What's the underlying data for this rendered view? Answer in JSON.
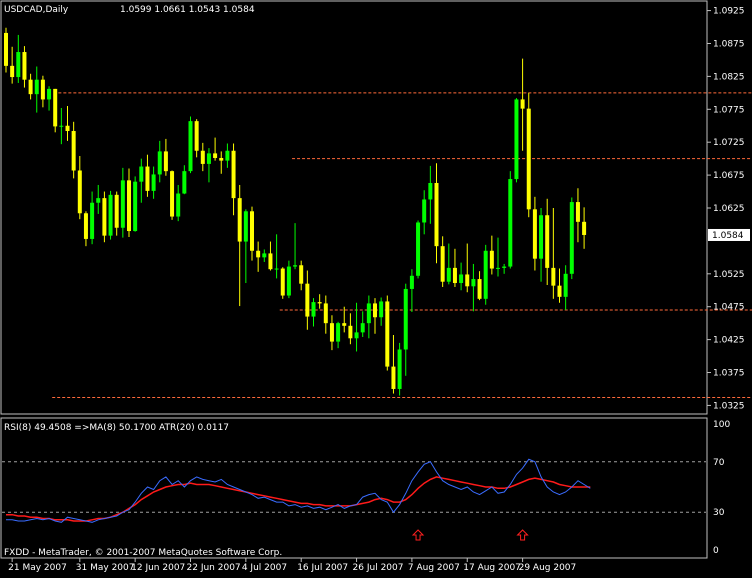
{
  "chart_data": [
    {
      "type": "candlestick",
      "title": "USDCAD,Daily",
      "ohlc_readout": "1.0599 1.0661 1.0543 1.0584",
      "current_price_label": "1.0584",
      "current_price": 1.0584,
      "ylim": [
        1.0315,
        1.0935
      ],
      "price_ticks": [
        {
          "v": 1.0925,
          "label": "1.0925"
        },
        {
          "v": 1.0875,
          "label": "1.0875"
        },
        {
          "v": 1.0825,
          "label": "1.0825"
        },
        {
          "v": 1.0775,
          "label": "1.0775"
        },
        {
          "v": 1.0725,
          "label": "1.0725"
        },
        {
          "v": 1.0675,
          "label": "1.0675"
        },
        {
          "v": 1.0625,
          "label": "1.0625"
        },
        {
          "v": 1.0525,
          "label": "1.0525"
        },
        {
          "v": 1.0475,
          "label": "1.0475"
        },
        {
          "v": 1.0425,
          "label": "1.0425"
        },
        {
          "v": 1.0375,
          "label": "1.0375"
        },
        {
          "v": 1.0325,
          "label": "1.0325"
        }
      ],
      "bull_color": "#00ff00",
      "bear_color": "#ffff00",
      "level_color": "#ff6a3a",
      "levels": [
        {
          "price": 1.08,
          "from": 9,
          "to": 134
        },
        {
          "price": 1.07,
          "from": 47,
          "to": 134
        },
        {
          "price": 1.047,
          "from": 45,
          "to": 134
        },
        {
          "price": 1.0337,
          "from": 8,
          "to": 134
        }
      ],
      "candles": [
        [
          1.0891,
          1.0899,
          1.0831,
          1.0841
        ],
        [
          1.0841,
          1.087,
          1.0814,
          1.0824
        ],
        [
          1.0824,
          1.0888,
          1.0815,
          1.0862
        ],
        [
          1.0862,
          1.0871,
          1.0808,
          1.082
        ],
        [
          1.082,
          1.0829,
          1.079,
          1.0798
        ],
        [
          1.0798,
          1.084,
          1.077,
          1.082
        ],
        [
          1.082,
          1.0826,
          1.0778,
          1.079
        ],
        [
          1.079,
          1.081,
          1.0773,
          1.0806
        ],
        [
          1.0806,
          1.0806,
          1.074,
          1.0749
        ],
        [
          1.0749,
          1.0777,
          1.0722,
          1.075
        ],
        [
          1.075,
          1.078,
          1.0727,
          1.0742
        ],
        [
          1.0742,
          1.0756,
          1.067,
          1.0682
        ],
        [
          1.0682,
          1.0704,
          1.0608,
          1.0617
        ],
        [
          1.0617,
          1.062,
          1.0567,
          1.0578
        ],
        [
          1.0578,
          1.065,
          1.057,
          1.0633
        ],
        [
          1.0633,
          1.066,
          1.0616,
          1.064
        ],
        [
          1.064,
          1.065,
          1.0573,
          1.0583
        ],
        [
          1.0583,
          1.0651,
          1.0577,
          1.0645
        ],
        [
          1.0645,
          1.065,
          1.0583,
          1.0595
        ],
        [
          1.0595,
          1.0686,
          1.058,
          1.0667
        ],
        [
          1.0667,
          1.0685,
          1.0581,
          1.059
        ],
        [
          1.059,
          1.0673,
          1.0589,
          1.0665
        ],
        [
          1.0665,
          1.07,
          1.0633,
          1.0688
        ],
        [
          1.0688,
          1.0706,
          1.0642,
          1.0651
        ],
        [
          1.0651,
          1.0688,
          1.0639,
          1.0676
        ],
        [
          1.0676,
          1.0727,
          1.0664,
          1.0711
        ],
        [
          1.0711,
          1.073,
          1.0674,
          1.0681
        ],
        [
          1.0681,
          1.0682,
          1.0607,
          1.0612
        ],
        [
          1.0612,
          1.066,
          1.0605,
          1.0647
        ],
        [
          1.0647,
          1.069,
          1.0646,
          1.0681
        ],
        [
          1.0681,
          1.0764,
          1.0678,
          1.0757
        ],
        [
          1.0757,
          1.076,
          1.0702,
          1.0712
        ],
        [
          1.0712,
          1.0724,
          1.0681,
          1.0692
        ],
        [
          1.0692,
          1.0716,
          1.0664,
          1.0708
        ],
        [
          1.0708,
          1.0732,
          1.0697,
          1.0701
        ],
        [
          1.0701,
          1.0711,
          1.0677,
          1.0697
        ],
        [
          1.0697,
          1.0723,
          1.0686,
          1.0712
        ],
        [
          1.0712,
          1.0723,
          1.0614,
          1.064
        ],
        [
          1.064,
          1.066,
          1.0476,
          1.0574
        ],
        [
          1.0574,
          1.0623,
          1.0511,
          1.062
        ],
        [
          1.062,
          1.0627,
          1.0545,
          1.056
        ],
        [
          1.056,
          1.0574,
          1.0528,
          1.055
        ],
        [
          1.055,
          1.0562,
          1.0543,
          1.0556
        ],
        [
          1.0556,
          1.0574,
          1.053,
          1.0532
        ],
        [
          1.0532,
          1.0585,
          1.0518,
          1.0533
        ],
        [
          1.0533,
          1.0535,
          1.0487,
          1.0492
        ],
        [
          1.0492,
          1.0545,
          1.0488,
          1.0536
        ],
        [
          1.0536,
          1.0602,
          1.0532,
          1.0538
        ],
        [
          1.0538,
          1.0545,
          1.05,
          1.051
        ],
        [
          1.051,
          1.053,
          1.044,
          1.046
        ],
        [
          1.046,
          1.0488,
          1.0445,
          1.0482
        ],
        [
          1.0482,
          1.0494,
          1.0472,
          1.048
        ],
        [
          1.048,
          1.0492,
          1.0434,
          1.045
        ],
        [
          1.045,
          1.0462,
          1.0409,
          1.0422
        ],
        [
          1.0422,
          1.0452,
          1.0412,
          1.045
        ],
        [
          1.045,
          1.0475,
          1.0436,
          1.0446
        ],
        [
          1.0446,
          1.0465,
          1.0418,
          1.0427
        ],
        [
          1.0427,
          1.0481,
          1.0407,
          1.0436
        ],
        [
          1.0436,
          1.0468,
          1.0429,
          1.045
        ],
        [
          1.045,
          1.0492,
          1.0427,
          1.048
        ],
        [
          1.048,
          1.0488,
          1.0434,
          1.0459
        ],
        [
          1.0459,
          1.0489,
          1.0446,
          1.0483
        ],
        [
          1.0483,
          1.0492,
          1.0378,
          1.0384
        ],
        [
          1.0384,
          1.0432,
          1.0343,
          1.035
        ],
        [
          1.035,
          1.042,
          1.034,
          1.041
        ],
        [
          1.041,
          1.051,
          1.037,
          1.0502
        ],
        [
          1.0502,
          1.0532,
          1.0467,
          1.0522
        ],
        [
          1.0522,
          1.0606,
          1.0518,
          1.0603
        ],
        [
          1.0603,
          1.0652,
          1.0585,
          1.0638
        ],
        [
          1.0638,
          1.0689,
          1.0601,
          1.0663
        ],
        [
          1.0663,
          1.0693,
          1.0541,
          1.0567
        ],
        [
          1.0567,
          1.0582,
          1.0505,
          1.0513
        ],
        [
          1.0513,
          1.0571,
          1.0509,
          1.0534
        ],
        [
          1.0534,
          1.0563,
          1.0505,
          1.0511
        ],
        [
          1.0511,
          1.0542,
          1.05,
          1.0524
        ],
        [
          1.0524,
          1.0571,
          1.0497,
          1.0506
        ],
        [
          1.0506,
          1.054,
          1.0468,
          1.0517
        ],
        [
          1.0517,
          1.0529,
          1.0485,
          1.0487
        ],
        [
          1.0487,
          1.0569,
          1.0478,
          1.056
        ],
        [
          1.056,
          1.0583,
          1.0524,
          1.0533
        ],
        [
          1.0533,
          1.058,
          1.0521,
          1.0534
        ],
        [
          1.0534,
          1.054,
          1.0525,
          1.0536
        ],
        [
          1.0536,
          1.0681,
          1.0533,
          1.0669
        ],
        [
          1.0669,
          1.0792,
          1.0664,
          1.079
        ],
        [
          1.079,
          1.0852,
          1.0712,
          1.0776
        ],
        [
          1.0776,
          1.08,
          1.0611,
          1.0623
        ],
        [
          1.0623,
          1.0642,
          1.053,
          1.0548
        ],
        [
          1.0548,
          1.0625,
          1.0513,
          1.0614
        ],
        [
          1.0614,
          1.0639,
          1.0508,
          1.0534
        ],
        [
          1.0534,
          1.0625,
          1.0487,
          1.0507
        ],
        [
          1.0507,
          1.0533,
          1.0481,
          1.049
        ],
        [
          1.049,
          1.0538,
          1.047,
          1.0525
        ],
        [
          1.0525,
          1.0641,
          1.0517,
          1.0634
        ],
        [
          1.0634,
          1.0655,
          1.0573,
          1.0604
        ],
        [
          1.0604,
          1.0626,
          1.0563,
          1.0584
        ]
      ],
      "x_labels": [
        {
          "i": 1,
          "label": "21 May 2007"
        },
        {
          "i": 12,
          "label": "31 May 2007"
        },
        {
          "i": 21,
          "label": "12 Jun 2007"
        },
        {
          "i": 30,
          "label": "22 Jun 2007"
        },
        {
          "i": 39,
          "label": "4 Jul 2007"
        },
        {
          "i": 48,
          "label": "16 Jul 2007"
        },
        {
          "i": 57,
          "label": "26 Jul 2007"
        },
        {
          "i": 66,
          "label": "7 Aug 2007"
        },
        {
          "i": 75,
          "label": "17 Aug 2007"
        },
        {
          "i": 84,
          "label": "29 Aug 2007"
        }
      ]
    },
    {
      "type": "line",
      "title": "RSI(8) 49.4508 =>MA(8) 50.1700 ATR(20) 0.0117",
      "ylim": [
        0,
        100
      ],
      "ticks": [
        {
          "v": 100,
          "label": "100"
        },
        {
          "v": 70,
          "label": "70"
        },
        {
          "v": 30,
          "label": "30"
        },
        {
          "v": 0,
          "label": "0"
        }
      ],
      "levels": [
        70,
        30
      ],
      "level_color": "#a0a0a0",
      "rsi_color": "#3a6cff",
      "ma_color": "#ff1a1a",
      "arrow_color": "#ff2020",
      "arrows": [
        67,
        84
      ],
      "rsi": [
        24,
        24,
        23,
        23,
        24,
        25,
        24,
        25,
        23,
        22,
        26,
        25,
        24,
        23,
        22,
        24,
        25,
        26,
        27,
        30,
        32,
        38,
        45,
        50,
        48,
        55,
        58,
        52,
        55,
        50,
        55,
        58,
        56,
        55,
        54,
        56,
        52,
        50,
        48,
        46,
        44,
        41,
        42,
        40,
        38,
        38,
        35,
        36,
        34,
        35,
        33,
        34,
        32,
        34,
        36,
        33,
        35,
        36,
        42,
        44,
        45,
        40,
        38,
        30,
        36,
        45,
        55,
        62,
        68,
        70,
        62,
        55,
        52,
        50,
        48,
        50,
        46,
        44,
        47,
        50,
        45,
        46,
        52,
        60,
        65,
        72,
        70,
        58,
        50,
        46,
        44,
        46,
        50,
        55,
        52,
        49
      ],
      "ma": [
        28,
        28,
        27,
        27,
        26,
        26,
        25,
        25,
        24,
        24,
        24,
        23,
        23,
        23,
        24,
        25,
        25,
        26,
        28,
        30,
        33,
        36,
        40,
        43,
        46,
        48,
        50,
        51,
        52,
        52,
        53,
        52,
        52,
        52,
        51,
        50,
        49,
        48,
        47,
        46,
        45,
        44,
        43,
        42,
        41,
        40,
        39,
        38,
        37,
        37,
        36,
        36,
        35,
        35,
        35,
        35,
        35,
        36,
        37,
        38,
        40,
        41,
        40,
        38,
        38,
        40,
        44,
        49,
        53,
        56,
        58,
        57,
        56,
        55,
        54,
        53,
        52,
        51,
        50,
        50,
        49,
        49,
        50,
        52,
        54,
        56,
        57,
        56,
        55,
        54,
        52,
        51,
        50,
        50,
        50,
        50
      ]
    }
  ],
  "footer": {
    "copyright": "FXDD - MetaTrader, © 2001-2007 MetaQuotes Software Corp."
  }
}
